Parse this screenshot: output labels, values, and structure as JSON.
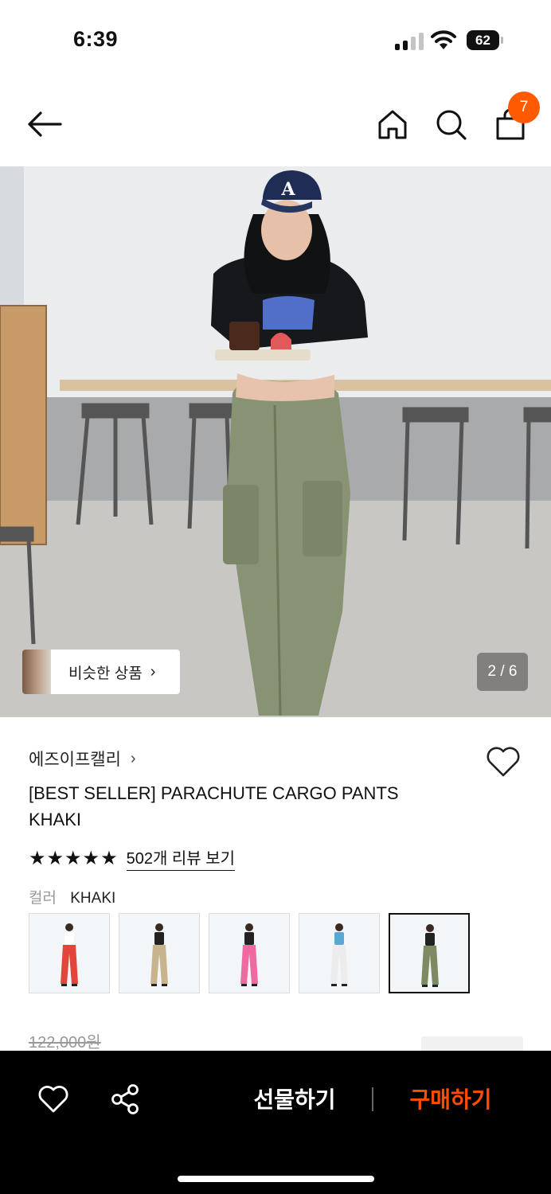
{
  "status_bar": {
    "time": "6:39",
    "battery": "62"
  },
  "nav": {
    "back_icon": "arrow-left-icon",
    "home_icon": "home-icon",
    "search_icon": "search-icon",
    "cart_icon": "shopping-bag-icon",
    "cart_badge": "7"
  },
  "hero": {
    "similar_products_label": "비슷한 상품",
    "similar_arrow": "›",
    "page_indicator": "2 / 6"
  },
  "product": {
    "brand": "에즈이프캘리",
    "brand_arrow": "›",
    "title": "[BEST SELLER] PARACHUTE CARGO PANTS KHAKI",
    "rating": 5,
    "stars": "★★★★★",
    "review_link": "502개 리뷰 보기",
    "color_label": "컬러",
    "color_value": "KHAKI",
    "swatches": [
      {
        "name": "red",
        "color": "#e2463a"
      },
      {
        "name": "beige",
        "color": "#c8b48c"
      },
      {
        "name": "pink",
        "color": "#ef6aa0"
      },
      {
        "name": "white",
        "color": "#ececec"
      },
      {
        "name": "khaki",
        "color": "#7d8a63",
        "selected": true
      }
    ],
    "original_price": "122,000원"
  },
  "bottom_bar": {
    "gift_label": "선물하기",
    "buy_label": "구매하기",
    "accent_color": "#ff4d00"
  }
}
